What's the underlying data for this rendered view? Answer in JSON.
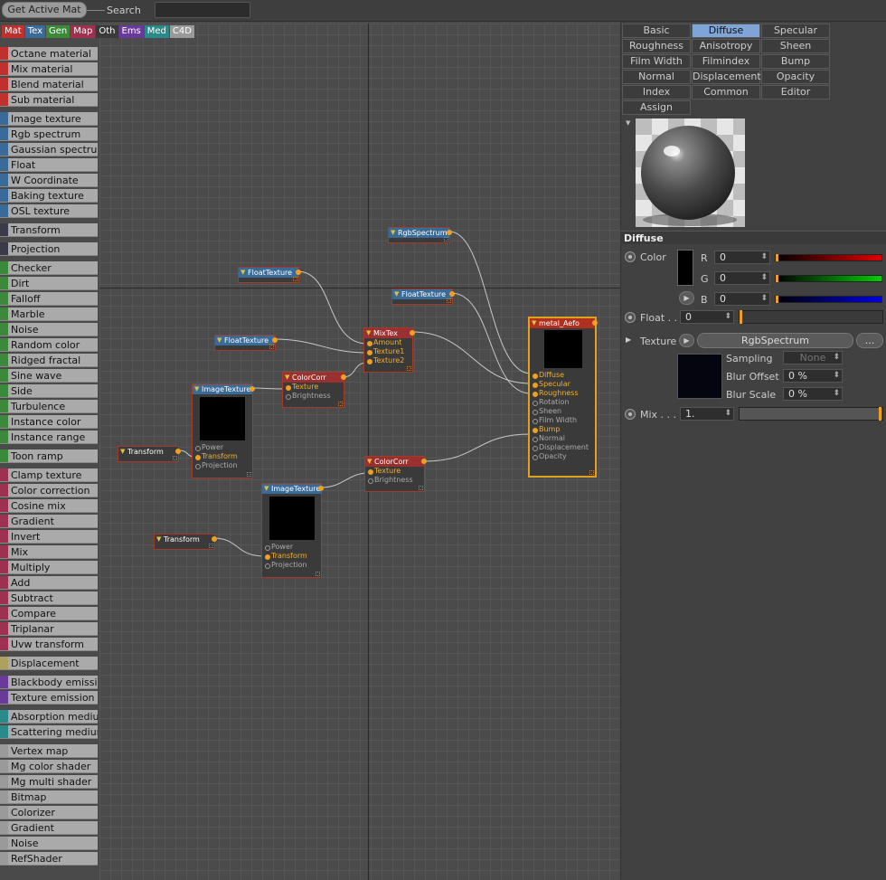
{
  "topbar": {
    "get_active_label": "Get Active Mat",
    "search_label": "Search",
    "search_value": ""
  },
  "categories": [
    {
      "label": "Mat",
      "color": "#c0302c"
    },
    {
      "label": "Tex",
      "color": "#3a6a9a"
    },
    {
      "label": "Gen",
      "color": "#3a8a3a"
    },
    {
      "label": "Map",
      "color": "#a03050"
    },
    {
      "label": "Oth",
      "color": "#3a3a3a"
    },
    {
      "label": "Ems",
      "color": "#6a3a9a"
    },
    {
      "label": "Med",
      "color": "#2a8a8a"
    },
    {
      "label": "C4D",
      "color": "#9a9a9a"
    }
  ],
  "palette": [
    {
      "label": "Octane material",
      "color": "#c0302c"
    },
    {
      "label": "Mix material",
      "color": "#c0302c"
    },
    {
      "label": "Blend material",
      "color": "#c0302c"
    },
    {
      "label": "Sub material",
      "color": "#c0302c"
    },
    {
      "label": "Image texture",
      "color": "#3a6a9a"
    },
    {
      "label": "Rgb spectrum",
      "color": "#3a6a9a"
    },
    {
      "label": "Gaussian spectrum",
      "color": "#3a6a9a"
    },
    {
      "label": "Float",
      "color": "#3a6a9a"
    },
    {
      "label": "W Coordinate",
      "color": "#3a6a9a"
    },
    {
      "label": "Baking texture",
      "color": "#3a6a9a"
    },
    {
      "label": "OSL texture",
      "color": "#3a6a9a"
    },
    {
      "label": "Transform",
      "color": "#3a3a4a"
    },
    {
      "label": "Projection",
      "color": "#3a3a4a"
    },
    {
      "label": "Checker",
      "color": "#3a8a3a"
    },
    {
      "label": "Dirt",
      "color": "#3a8a3a"
    },
    {
      "label": "Falloff",
      "color": "#3a8a3a"
    },
    {
      "label": "Marble",
      "color": "#3a8a3a"
    },
    {
      "label": "Noise",
      "color": "#3a8a3a"
    },
    {
      "label": "Random color",
      "color": "#3a8a3a"
    },
    {
      "label": "Ridged fractal",
      "color": "#3a8a3a"
    },
    {
      "label": "Sine wave",
      "color": "#3a8a3a"
    },
    {
      "label": "Side",
      "color": "#3a8a3a"
    },
    {
      "label": "Turbulence",
      "color": "#3a8a3a"
    },
    {
      "label": "Instance color",
      "color": "#3a8a3a"
    },
    {
      "label": "Instance range",
      "color": "#3a8a3a"
    },
    {
      "label": "Toon ramp",
      "color": "#3a8a3a"
    },
    {
      "label": "Clamp texture",
      "color": "#a03050"
    },
    {
      "label": "Color correction",
      "color": "#a03050"
    },
    {
      "label": "Cosine mix",
      "color": "#a03050"
    },
    {
      "label": "Gradient",
      "color": "#a03050"
    },
    {
      "label": "Invert",
      "color": "#a03050"
    },
    {
      "label": "Mix",
      "color": "#a03050"
    },
    {
      "label": "Multiply",
      "color": "#a03050"
    },
    {
      "label": "Add",
      "color": "#a03050"
    },
    {
      "label": "Subtract",
      "color": "#a03050"
    },
    {
      "label": "Compare",
      "color": "#a03050"
    },
    {
      "label": "Triplanar",
      "color": "#a03050"
    },
    {
      "label": "Uvw transform",
      "color": "#a03050"
    },
    {
      "label": "Displacement",
      "color": "#b0a060"
    },
    {
      "label": "Blackbody emission",
      "color": "#6a3a9a"
    },
    {
      "label": "Texture emission",
      "color": "#6a3a9a"
    },
    {
      "label": "Absorption medium",
      "color": "#2a8a8a"
    },
    {
      "label": "Scattering medium",
      "color": "#2a8a8a"
    },
    {
      "label": "Vertex map",
      "color": "#9a9a9a"
    },
    {
      "label": "Mg color shader",
      "color": "#9a9a9a"
    },
    {
      "label": "Mg multi shader",
      "color": "#9a9a9a"
    },
    {
      "label": "Bitmap",
      "color": "#9a9a9a"
    },
    {
      "label": "Colorizer",
      "color": "#9a9a9a"
    },
    {
      "label": "Gradient",
      "color": "#9a9a9a"
    },
    {
      "label": "Noise",
      "color": "#9a9a9a"
    },
    {
      "label": "RefShader",
      "color": "#9a9a9a"
    }
  ],
  "nodes": {
    "rgb_spectrum": {
      "title": "RgbSpectrum"
    },
    "float_texture_1": {
      "title": "FloatTexture"
    },
    "float_texture_2": {
      "title": "FloatTexture"
    },
    "float_texture_3": {
      "title": "FloatTexture"
    },
    "mixtex": {
      "title": "MixTex",
      "ports": [
        "Amount",
        "Texture1",
        "Texture2"
      ]
    },
    "colorcorr_1": {
      "title": "ColorCorr",
      "ports": [
        "Texture",
        "Brightness"
      ]
    },
    "colorcorr_2": {
      "title": "ColorCorr",
      "ports": [
        "Texture",
        "Brightness"
      ]
    },
    "image_texture_1": {
      "title": "ImageTexture",
      "ports": [
        "Power",
        "Transform",
        "Projection"
      ]
    },
    "image_texture_2": {
      "title": "ImageTexture",
      "ports": [
        "Power",
        "Transform",
        "Projection"
      ]
    },
    "transform_1": {
      "title": "Transform"
    },
    "transform_2": {
      "title": "Transform"
    },
    "material": {
      "title": "metal_Aefo",
      "ports": [
        "Diffuse",
        "Specular",
        "Roughness",
        "Rotation",
        "Sheen",
        "Film Width",
        "Bump",
        "Normal",
        "Displacement",
        "Opacity"
      ]
    }
  },
  "right_tabs": [
    [
      "Basic",
      "Diffuse",
      "Specular"
    ],
    [
      "Roughness",
      "Anisotropy",
      "Sheen"
    ],
    [
      "Film Width",
      "Filmindex",
      "Bump"
    ],
    [
      "Normal",
      "Displacement",
      "Opacity"
    ],
    [
      "Index",
      "Common",
      "Editor"
    ],
    [
      "Assign"
    ]
  ],
  "active_tab": "Diffuse",
  "diffuse": {
    "section_title": "Diffuse",
    "color_label": "Color",
    "r_label": "R",
    "g_label": "G",
    "b_label": "B",
    "r_value": "0",
    "g_value": "0",
    "b_value": "0",
    "float_label": "Float . .",
    "float_value": "0",
    "texture_label": "Texture",
    "texture_value": "RgbSpectrum",
    "more_button": "...",
    "sampling_label": "Sampling",
    "sampling_value": "None",
    "blur_offset_label": "Blur Offset",
    "blur_offset_value": "0 %",
    "blur_scale_label": "Blur Scale",
    "blur_scale_value": "0 %",
    "mix_label": "Mix . . .",
    "mix_value": "1."
  }
}
